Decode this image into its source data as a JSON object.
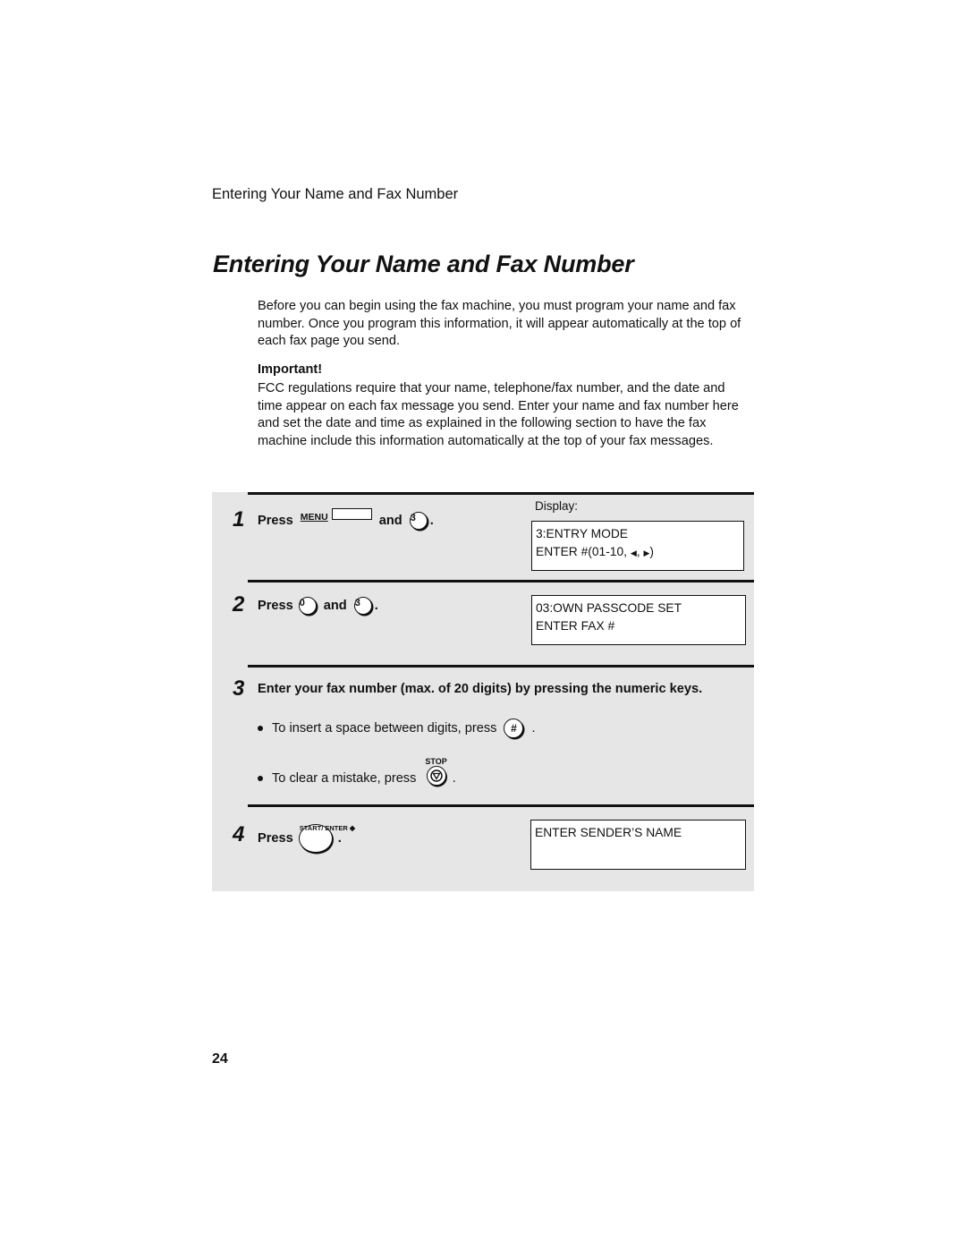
{
  "running_head": "Entering Your Name and Fax Number",
  "title": "Entering Your Name and Fax Number",
  "intro": "Before you can begin using the fax machine, you must program your name and fax number. Once you program this information, it will appear automatically at the top of each fax page you send.",
  "important": {
    "label": "Important!",
    "text": "FCC regulations require that your name, telephone/fax number, and the date and time appear on each fax message you send. Enter your name and fax number here and set the date and time as explained in the following section to have the fax machine include this information automatically at the top of your fax messages."
  },
  "display_label": "Display:",
  "steps": [
    {
      "number": "1",
      "press": "Press",
      "key1": "MENU",
      "and": "and",
      "key2": "3",
      "end": ".",
      "display": [
        "3:ENTRY MODE",
        "ENTER #(01-10,",
        ",",
        ")"
      ]
    },
    {
      "number": "2",
      "press": "Press",
      "key1": "0",
      "and": "and",
      "key2": "3",
      "end": ".",
      "display": [
        "03:OWN PASSCODE SET",
        "ENTER FAX #"
      ]
    },
    {
      "number": "3",
      "text": "Enter your fax number (max. of 20 digits) by pressing the numeric keys.",
      "bullets": [
        {
          "text": "To insert  a space between digits, press",
          "key": "#",
          "end": "."
        },
        {
          "text": "To clear a mistake, press",
          "key": "STOP",
          "end": "."
        }
      ]
    },
    {
      "number": "4",
      "press": "Press",
      "key": [
        "START/",
        "ENTER"
      ],
      "end": ".",
      "display": [
        "ENTER SENDER’S NAME"
      ]
    }
  ],
  "page_number": "24"
}
